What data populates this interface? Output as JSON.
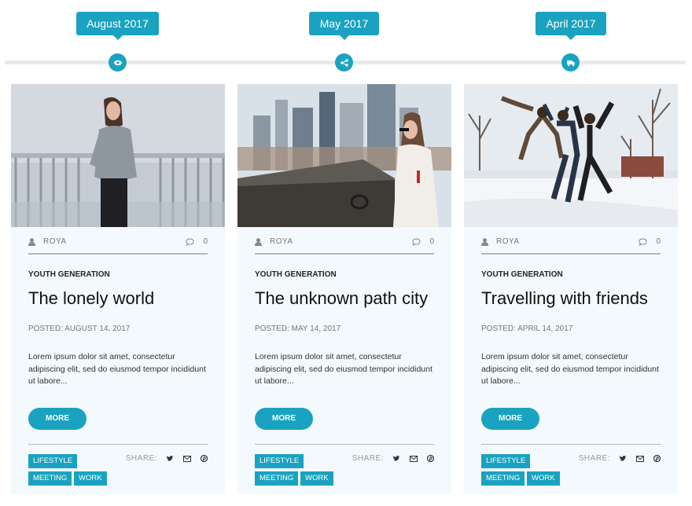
{
  "colors": {
    "accent": "#1aa3c0",
    "card_bg": "#f3f9fc",
    "line": "#e8eaec"
  },
  "timeline": [
    {
      "date": "August 2017",
      "icon": "eye-icon"
    },
    {
      "date": "May 2017",
      "icon": "share-icon"
    },
    {
      "date": "April 2017",
      "icon": "truck-icon"
    }
  ],
  "posts": [
    {
      "author": "ROYA",
      "comments": "0",
      "category": "YOUTH GENERATION",
      "title": "The lonely world",
      "posted": "POSTED: AUGUST 14, 2017",
      "excerpt": "Lorem ipsum dolor sit amet, consectetur adipiscing elit, sed do eiusmod tempor incididunt ut labore...",
      "more": "MORE",
      "share_label": "SHARE:",
      "tags": [
        "LIFESTYLE",
        "MEETING",
        "WORK"
      ]
    },
    {
      "author": "ROYA",
      "comments": "0",
      "category": "YOUTH GENERATION",
      "title": "The unknown path city",
      "posted": "POSTED: MAY 14, 2017",
      "excerpt": "Lorem ipsum dolor sit amet, consectetur adipiscing elit, sed do eiusmod tempor incididunt ut labore...",
      "more": "MORE",
      "share_label": "SHARE:",
      "tags": [
        "LIFESTYLE",
        "MEETING",
        "WORK"
      ]
    },
    {
      "author": "ROYA",
      "comments": "0",
      "category": "YOUTH GENERATION",
      "title": "Travelling with friends",
      "posted": "POSTED: APRIL 14, 2017",
      "excerpt": "Lorem ipsum dolor sit amet, consectetur adipiscing elit, sed do eiusmod tempor incididunt ut labore...",
      "more": "MORE",
      "share_label": "SHARE:",
      "tags": [
        "LIFESTYLE",
        "MEETING",
        "WORK"
      ]
    }
  ]
}
